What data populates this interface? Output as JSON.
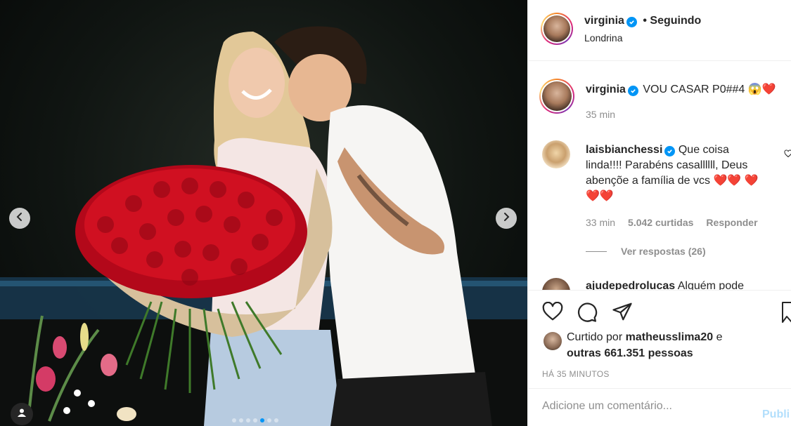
{
  "post": {
    "author": "virginia",
    "follow_status": "• Seguindo",
    "location": "Londrina"
  },
  "caption": {
    "username": "virginia",
    "text": "VOU CASAR P0##4",
    "emojis": "😱❤️",
    "time": "35 min"
  },
  "comments": [
    {
      "username": "laisbianchessi",
      "text": "Que coisa linda!!!! Parabéns casallllll, Deus abençõe a família de vcs",
      "hearts": "❤️❤️",
      "hearts2": "❤️❤️❤️",
      "time": "33 min",
      "likes": "5.042 curtidas",
      "reply": "Responder",
      "view_replies": "Ver respostas (26)"
    },
    {
      "username": "ajudepedrolucas",
      "text": "Alguém pode"
    }
  ],
  "likes": {
    "prefix": "Curtido por",
    "user": "matheusslima20",
    "conj": "e",
    "others": "outras 661.351 pessoas"
  },
  "timestamp": "HÁ 35 MINUTOS",
  "comment_input": {
    "placeholder": "Adicione um comentário...",
    "publish": "Publi"
  },
  "carousel": {
    "slides": 7,
    "active_index": 4
  },
  "colors": {
    "accent": "#0095f6",
    "publish_disabled": "#b2dffc",
    "heart": "#ed1c24"
  },
  "icons": [
    "chevron-left-icon",
    "chevron-right-icon",
    "user-tag-icon",
    "heart-icon",
    "comment-icon",
    "share-icon",
    "bookmark-icon",
    "verified-icon"
  ]
}
